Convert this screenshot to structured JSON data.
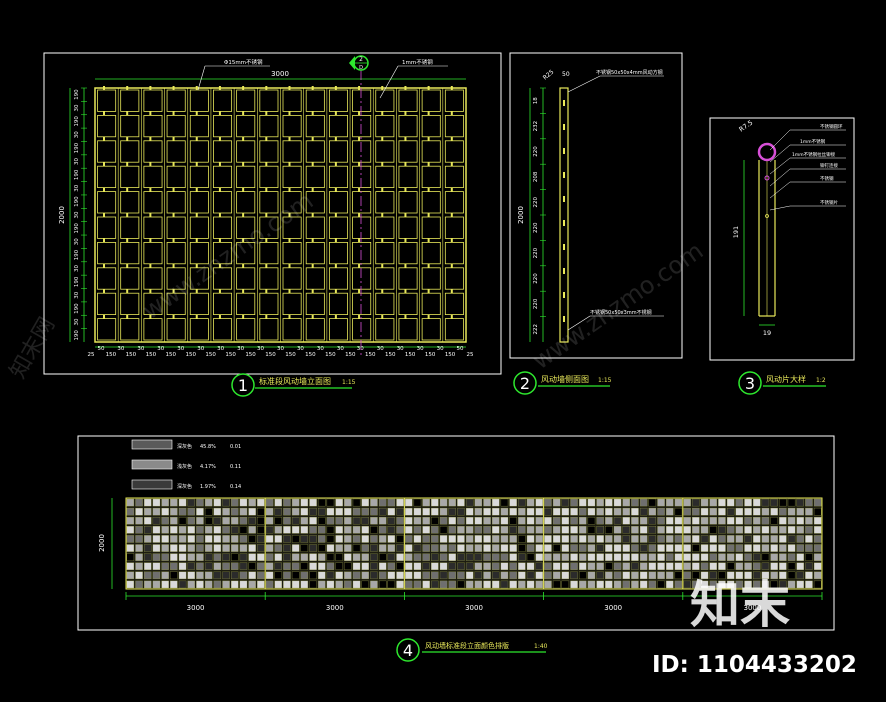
{
  "view1": {
    "number": "1",
    "title": "标准段风动墙立面图",
    "scale": "1:15",
    "width_dim": "3000",
    "height_dim": "2000",
    "callout_rod": "Φ15mm不锈钢",
    "callout_sheet": "1mm不锈钢",
    "section_mark": "2",
    "section_sheet": "D",
    "row_dims": [
      "190",
      "30",
      "190",
      "30",
      "190",
      "30",
      "190",
      "30",
      "190",
      "30",
      "190",
      "30",
      "190",
      "30",
      "190",
      "30",
      "190",
      "30",
      "190"
    ],
    "bottom_dims": [
      "25",
      "50",
      "150",
      "30",
      "150",
      "30",
      "150",
      "30",
      "150",
      "30",
      "150",
      "30",
      "150",
      "30",
      "150",
      "30",
      "150",
      "30",
      "150",
      "30",
      "150",
      "30",
      "150",
      "30",
      "150",
      "30",
      "150",
      "30",
      "150",
      "30",
      "150",
      "30",
      "150",
      "30",
      "150",
      "30",
      "150",
      "50",
      "25"
    ]
  },
  "view2": {
    "number": "2",
    "title": "风动墙侧面图",
    "scale": "1:15",
    "height_dim": "2000",
    "radius": "R25",
    "top_width": "50",
    "callout_top": "不锈钢50x50x4mm风动方钢",
    "callout_bottom": "不锈钢50x50x3mm不锈钢",
    "dims": [
      "18",
      "232",
      "220",
      "208",
      "220",
      "220",
      "220",
      "220",
      "220",
      "222"
    ]
  },
  "view3": {
    "number": "3",
    "title": "风动片大样",
    "scale": "1:2",
    "radius": "R7.5",
    "height_dim": "191",
    "width_dim": "19",
    "callouts": [
      "不锈钢圆环",
      "1mm不锈钢",
      "1mm不锈钢拉丝铆接",
      "铆钉连接",
      "不锈钢",
      "不锈钢片"
    ]
  },
  "view4": {
    "number": "4",
    "title": "风动墙标准段立面颜色排版",
    "scale": "1:40",
    "height_dim": "2000",
    "segment_dims": [
      "3000",
      "3000",
      "3000",
      "3000",
      "3000"
    ],
    "legend": [
      {
        "name": "深灰色",
        "value": "45.8%",
        "pct": "0.01"
      },
      {
        "name": "浅灰色",
        "value": "4.17%",
        "pct": "0.11"
      },
      {
        "name": "深灰色",
        "value": "1.97%",
        "pct": "0.14"
      }
    ]
  },
  "watermark": {
    "site": "www.znzmo.com",
    "brand": "知末网",
    "logo": "知末",
    "id_label": "ID: 1104433202"
  },
  "colors": {
    "frame": "#ffffff",
    "grid": "#e8e85a",
    "dim": "#2ee82e",
    "accent": "#d84fd8",
    "callout": "#ffffff"
  }
}
